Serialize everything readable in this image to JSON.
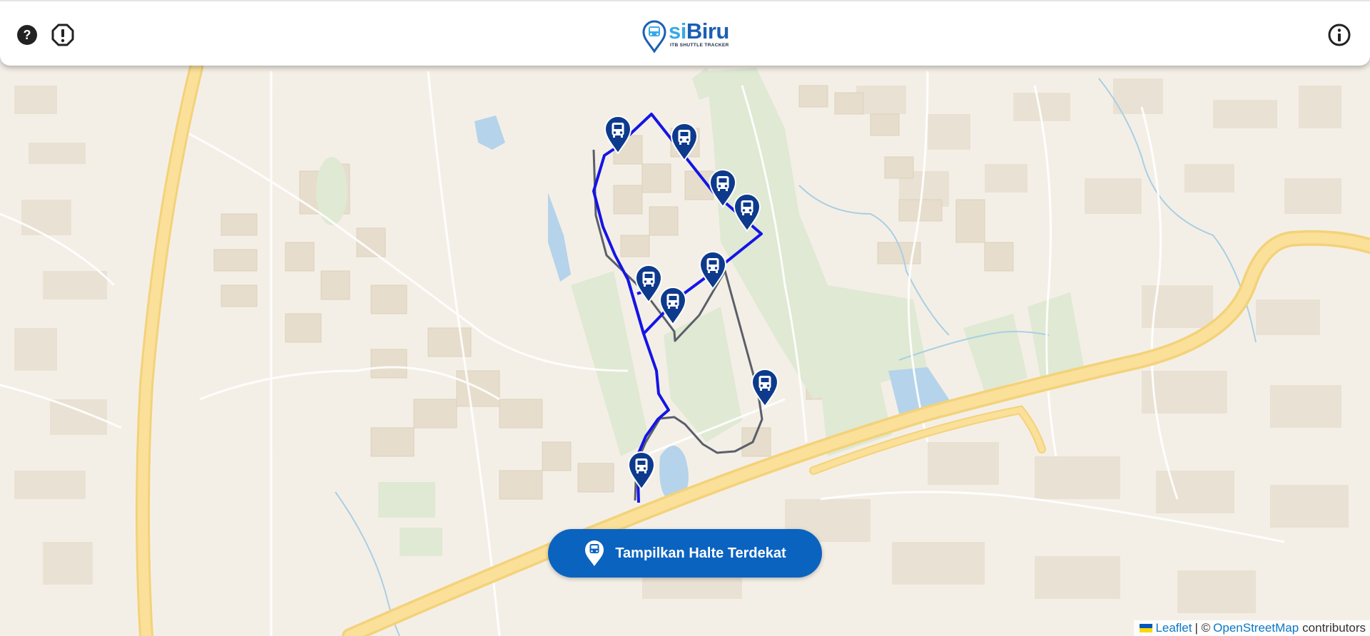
{
  "header": {
    "help_icon": "question-circle-icon",
    "report_icon": "exclamation-octagon-icon",
    "info_icon": "info-circle-icon",
    "logo": {
      "part1": "si",
      "part2": "Biru",
      "subtitle": "ITB SHUTTLE TRACKER",
      "color_light": "#38a9e6",
      "color_dark": "#1b5fb4"
    }
  },
  "map": {
    "route_colors": {
      "active": "#1414e6",
      "inactive": "#5a5f6a"
    },
    "marker_color": "#0d3a8c",
    "stop_count": 10
  },
  "nearest_button": {
    "label": "Tampilkan Halte Terdekat",
    "color": "#0b63c0"
  },
  "attribution": {
    "leaflet": "Leaflet",
    "separator": "| ©",
    "osm": "OpenStreetMap",
    "contributors": "contributors"
  }
}
